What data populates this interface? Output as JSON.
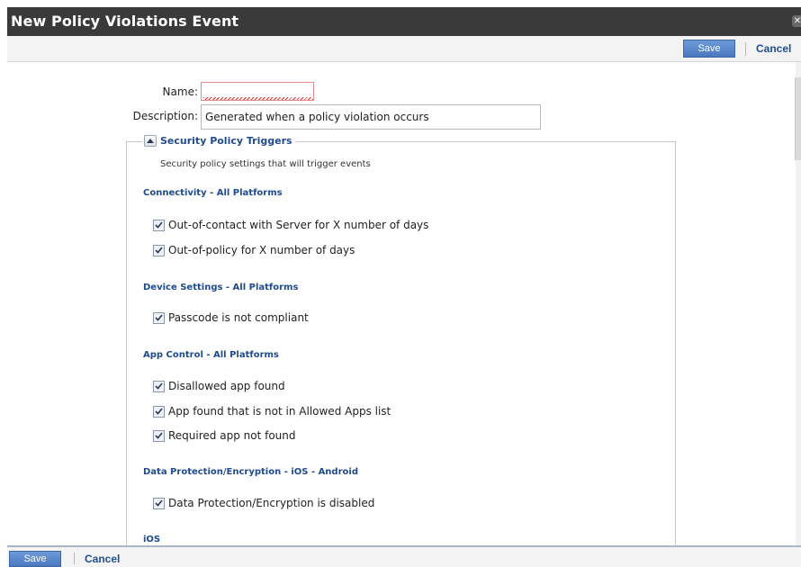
{
  "dialog": {
    "title": "New Policy Violations Event",
    "close_icon": "close-icon"
  },
  "toolbar": {
    "save_label": "Save",
    "cancel_label": "Cancel"
  },
  "form": {
    "name_label": "Name:",
    "name_value": "",
    "description_label": "Description:",
    "description_value": "Generated when a policy violation occurs"
  },
  "triggers": {
    "legend": "Security Policy Triggers",
    "subtitle": "Security policy settings that will trigger events",
    "sections": [
      {
        "header": "Connectivity - All Platforms",
        "items": [
          {
            "label": "Out-of-contact with Server for X number of days",
            "checked": true
          },
          {
            "label": "Out-of-policy for X number of days",
            "checked": true
          }
        ]
      },
      {
        "header": "Device Settings - All Platforms",
        "items": [
          {
            "label": "Passcode is not compliant",
            "checked": true
          }
        ]
      },
      {
        "header": "App Control - All Platforms",
        "items": [
          {
            "label": "Disallowed app found",
            "checked": true
          },
          {
            "label": "App found that is not in Allowed Apps list",
            "checked": true
          },
          {
            "label": "Required app not found",
            "checked": true
          }
        ]
      },
      {
        "header": "Data Protection/Encryption - iOS - Android",
        "items": [
          {
            "label": "Data Protection/Encryption is disabled",
            "checked": true
          }
        ]
      },
      {
        "header": "iOS",
        "items": []
      }
    ]
  },
  "colors": {
    "title_bar": "#3a3a3a",
    "accent": "#1f4b8e",
    "save_button": "#5684c9"
  }
}
